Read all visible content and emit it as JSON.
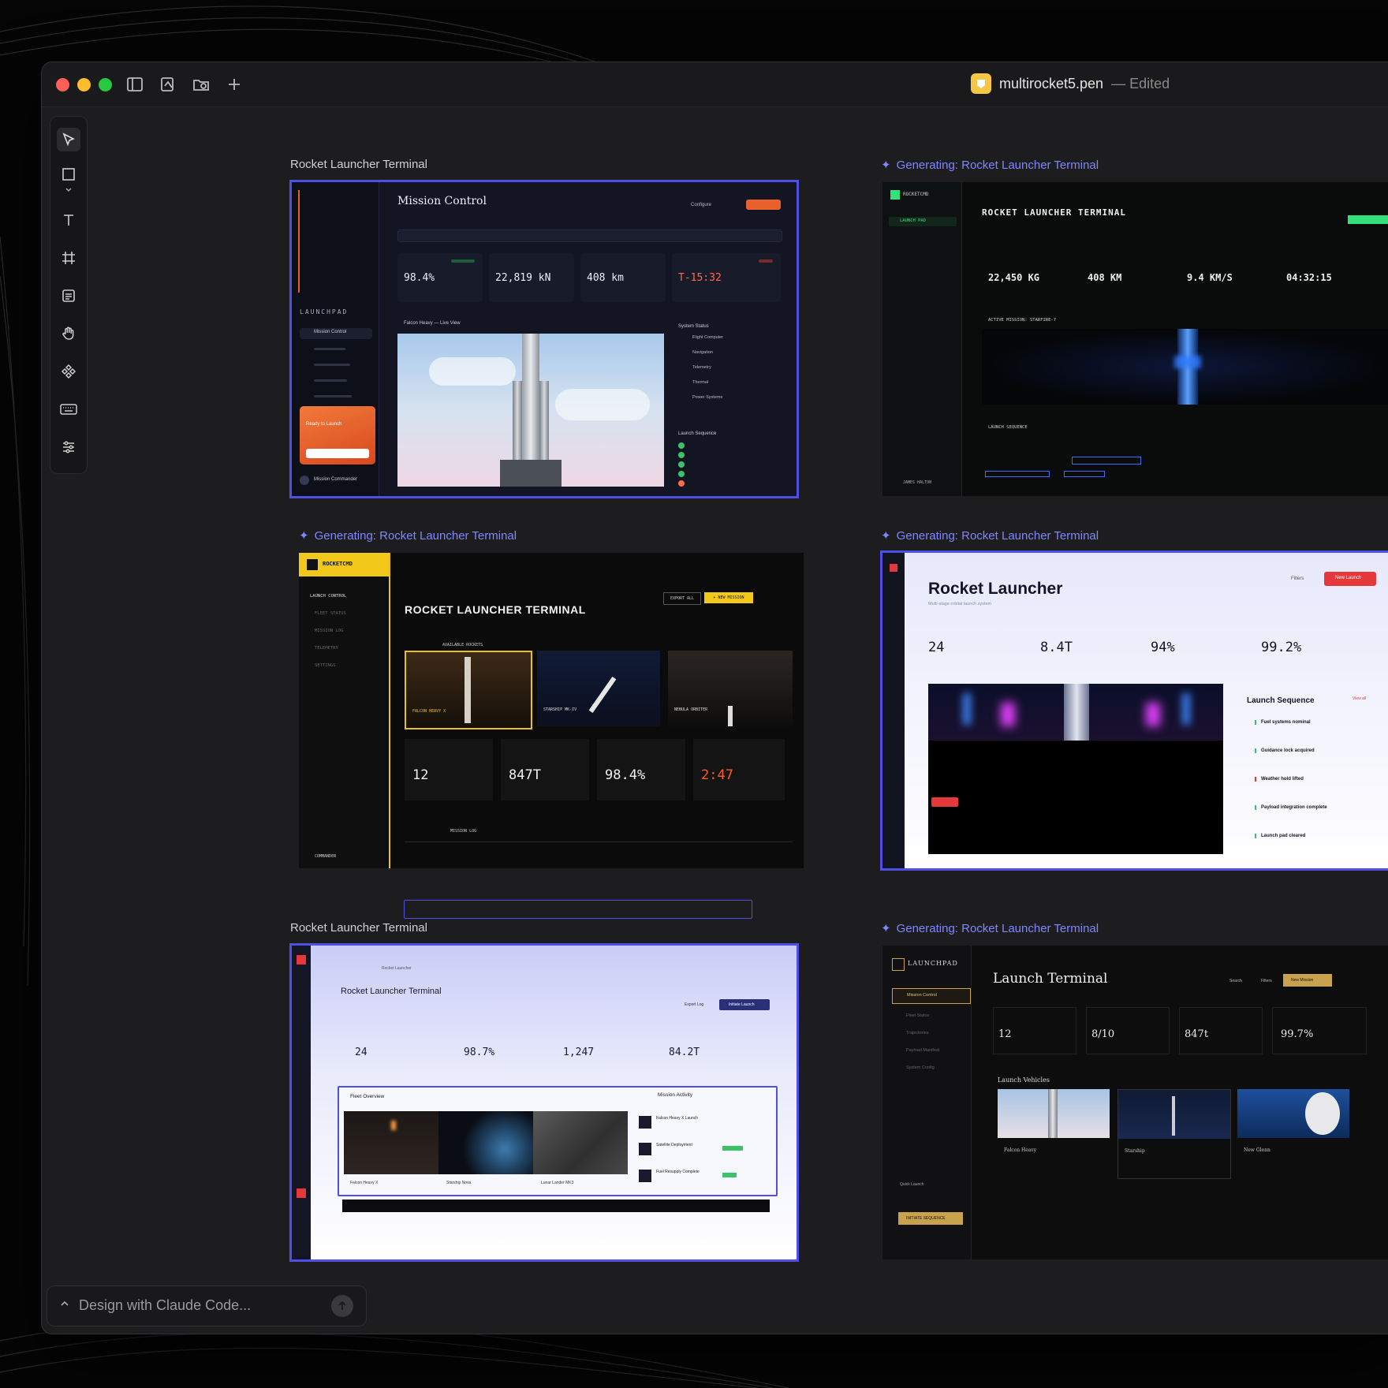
{
  "window": {
    "file_name": "multirocket5.pen",
    "status": "— Edited"
  },
  "toolbar": {
    "icons": [
      "sidebar-toggle-icon",
      "layers-icon",
      "folder-icon",
      "plus-icon"
    ]
  },
  "tools": [
    "pointer-icon",
    "rectangle-icon",
    "text-icon",
    "frame-icon",
    "note-icon",
    "hand-icon",
    "component-icon",
    "keyboard-icon",
    "sliders-icon"
  ],
  "frames": {
    "f1": {
      "label": "Rocket Launcher Terminal",
      "title": "Mission Control",
      "configure": "Configure",
      "launchpad": "LAUNCHPAD",
      "nav": [
        "Mission Control"
      ],
      "stats": [
        "98.4%",
        "22,819 kN",
        "408 km",
        "T-15:32"
      ],
      "live_view": "Falcon Heavy — Live View",
      "system_status": "System Status",
      "systems": [
        "Flight Computer",
        "Navigation",
        "Telemetry",
        "Thermal",
        "Power Systems"
      ],
      "launch_sequence": "Launch Sequence",
      "ready": "Ready to Launch",
      "user": "Mission Commander"
    },
    "f2": {
      "label": "Generating: Rocket Launcher Terminal",
      "brand": "ROCKETCMD",
      "nav_active": "LAUNCH PAD",
      "title": "ROCKET LAUNCHER TERMINAL",
      "stats": [
        "22,450 KG",
        "408 KM",
        "9.4 KM/S",
        "04:32:15"
      ],
      "active_mission": "ACTIVE MISSION: STARFIRE-7",
      "launch_sequence": "LAUNCH SEQUENCE",
      "user": "JAMES HALTON"
    },
    "f3": {
      "label": "Generating: Rocket Launcher Terminal",
      "brand": "ROCKETCMD",
      "nav": [
        "LAUNCH CONTROL",
        "FLEET STATUS",
        "MISSION LOG",
        "TELEMETRY",
        "SETTINGS"
      ],
      "title": "ROCKET LAUNCHER TERMINAL",
      "export": "EXPORT ALL",
      "new_mission": "+ NEW MISSION",
      "available": "AVAILABLE ROCKETS",
      "rockets": [
        "FALCON HEAVY X",
        "STARSHIP MK-IV",
        "NEBULA ORBITER"
      ],
      "stats": [
        "12",
        "847T",
        "98.4%",
        "2:47"
      ],
      "mission_log": "MISSION LOG",
      "user": "COMMANDER"
    },
    "f4": {
      "label": "Generating: Rocket Launcher Terminal",
      "title": "Rocket Launcher",
      "subtitle": "Multi-stage orbital launch system",
      "filters": "Filters",
      "new_launch": "New Launch",
      "stats": [
        "24",
        "8.4T",
        "94%",
        "99.2%"
      ],
      "launch_sequence": "Launch Sequence",
      "view_all": "View all",
      "steps": [
        "Fuel systems nominal",
        "Guidance lock acquired",
        "Weather hold lifted",
        "Payload integration complete",
        "Launch pad cleared"
      ]
    },
    "f5": {
      "label": "Rocket Launcher Terminal",
      "breadcrumb": "Rocket Launcher",
      "title": "Rocket Launcher Terminal",
      "export": "Export Log",
      "launch": "Initiate Launch",
      "stats": [
        "24",
        "98.7%",
        "1,247",
        "84.2T"
      ],
      "fleet": "Fleet Overview",
      "activity": "Mission Activity",
      "rockets": [
        "Falcon Heavy X",
        "Starship Nova",
        "Lunar Lander MK3"
      ],
      "activities": [
        "Falcon Heavy X Launch",
        "Satellite Deployment",
        "Fuel Resupply Complete"
      ]
    },
    "f6": {
      "label": "Generating: Rocket Launcher Terminal",
      "brand": "LAUNCHPAD",
      "nav": [
        "Mission Control",
        "Fleet Status",
        "Trajectories",
        "Payload Manifest",
        "System Config"
      ],
      "title": "Launch Terminal",
      "search": "Search",
      "filters": "Filters",
      "new_mission": "New Mission",
      "stats": [
        "12",
        "8/10",
        "847t",
        "99.7%"
      ],
      "vehicles": "Launch Vehicles",
      "rockets": [
        "Falcon Heavy",
        "Starship",
        "New Glenn"
      ],
      "quick": "Quick Launch",
      "initiate": "INITIATE SEQUENCE"
    }
  },
  "chat": {
    "placeholder": "Design with Claude Code..."
  }
}
